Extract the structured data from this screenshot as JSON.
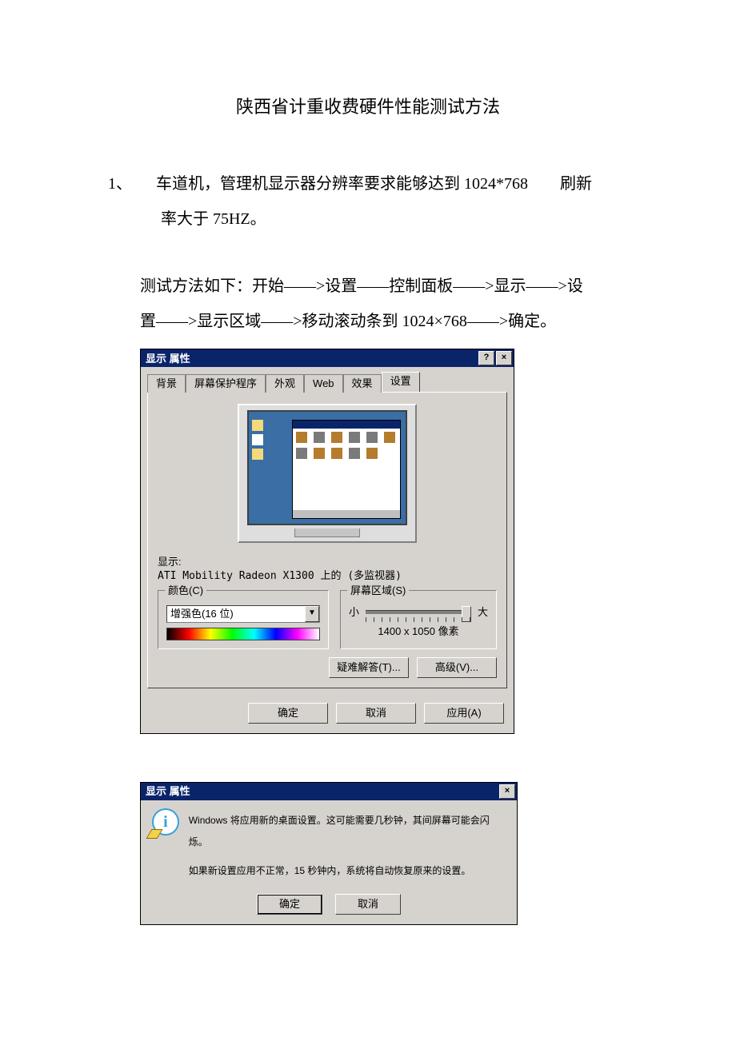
{
  "doc": {
    "title": "陕西省计重收费硬件性能测试方法",
    "item1_line1": "1、　　车道机，管理机显示器分辨率要求能够达到 1024*768　　刷新",
    "item1_line2": "率大于 75HZ。",
    "method_line1": "测试方法如下：开始——>设置——控制面板——>显示——>设",
    "method_line2": "置——>显示区域——>移动滚动条到 1024×768——>确定。"
  },
  "dlg1": {
    "title": "显示 属性",
    "help": "?",
    "close": "×",
    "tabs": {
      "bg": "背景",
      "saver": "屏幕保护程序",
      "appearance": "外观",
      "web": "Web",
      "effects": "效果",
      "settings": "设置"
    },
    "display_label": "显示:",
    "display_value": "ATI Mobility Radeon X1300 上的 (多监视器)",
    "color_legend": "颜色(C)",
    "color_value": "增强色(16 位)",
    "area_legend": "屏幕区域(S)",
    "area_small": "小",
    "area_large": "大",
    "area_value": "1400 x 1050 像素",
    "troubleshoot": "疑难解答(T)...",
    "advanced": "高级(V)...",
    "ok": "确定",
    "cancel": "取消",
    "apply": "应用(A)"
  },
  "dlg2": {
    "title": "显示 属性",
    "close": "×",
    "line1": "Windows 将应用新的桌面设置。这可能需要几秒钟，其间屏幕可能会闪烁。",
    "line2": "如果新设置应用不正常，15 秒钟内，系统将自动恢复原来的设置。",
    "ok": "确定",
    "cancel": "取消"
  }
}
